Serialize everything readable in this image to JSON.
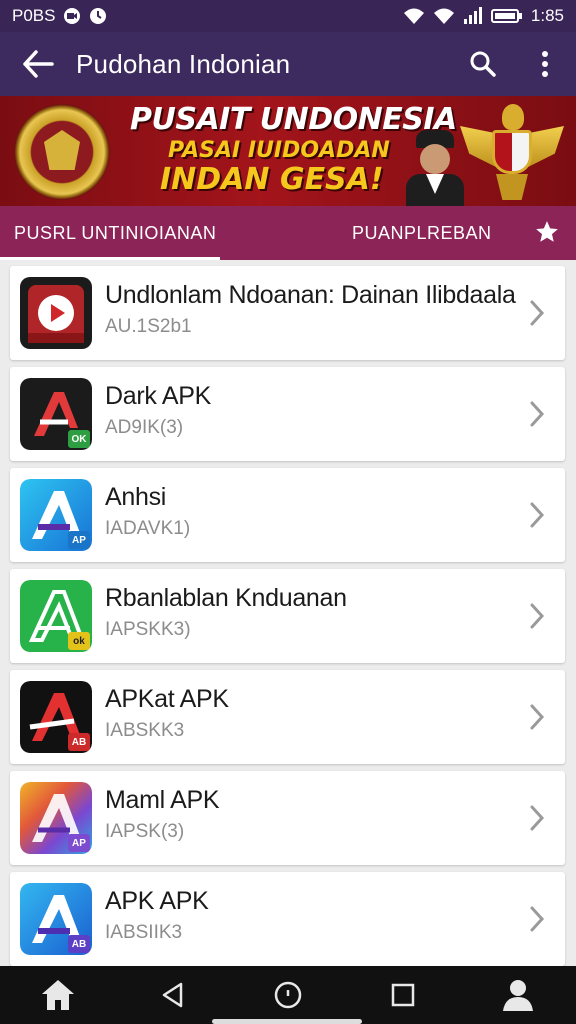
{
  "status_bar": {
    "left_text": "P0BS",
    "time": "1:85"
  },
  "app_bar": {
    "title": "Pudohan Indonian"
  },
  "banner": {
    "title": "PUSAIT UNDONESIA",
    "subtitle": "PASAI IUIDOADAN",
    "tagline": "INDAN GESA!"
  },
  "tabs": [
    {
      "label": "PUSRL UNTINIOIANAN"
    },
    {
      "label": "PUANPLREBAN"
    }
  ],
  "apps": [
    {
      "name": "Undlonlam Ndoanan: Dainan Ilibdaala",
      "sub": "AU.1S2b1",
      "icon": "youtube-style-icon",
      "accent": "#b02528"
    },
    {
      "name": "Dark APK",
      "sub": "AD9IK(3)",
      "icon": "a-logo-dark-icon",
      "accent": "#1b1b1b",
      "badge": "OK",
      "badge_color": "#2e9e43"
    },
    {
      "name": "Anhsi",
      "sub": "IADAVK1)",
      "icon": "a-logo-blue-icon",
      "accent": "#1fa3e6",
      "badge": "AP",
      "badge_color": "#1a74c8"
    },
    {
      "name": "Rbanlablan Knduanan",
      "sub": "IAPSKK3)",
      "icon": "a-logo-green-icon",
      "accent": "#27b24a",
      "badge": "ok",
      "badge_color": "#e3c21a"
    },
    {
      "name": "APKat APK",
      "sub": "IABSKK3",
      "icon": "a-logo-black-red-icon",
      "accent": "#111111",
      "badge": "AB",
      "badge_color": "#cc2a2a"
    },
    {
      "name": "Maml APK",
      "sub": "IAPSK(3)",
      "icon": "a-logo-rainbow-icon",
      "accent": "#e8a23a",
      "badge": "AP",
      "badge_color": "#7c4bd0"
    },
    {
      "name": "APK APK",
      "sub": "IABSIIK3",
      "icon": "a-logo-blue-purple-icon",
      "accent": "#1f8fe0",
      "badge": "AB",
      "badge_color": "#5b3fc4"
    }
  ],
  "colors": {
    "status_bar": "#3a2557",
    "app_bar": "#3d2a5e",
    "tab_bar": "#8d2458",
    "banner": "#a3141b"
  }
}
